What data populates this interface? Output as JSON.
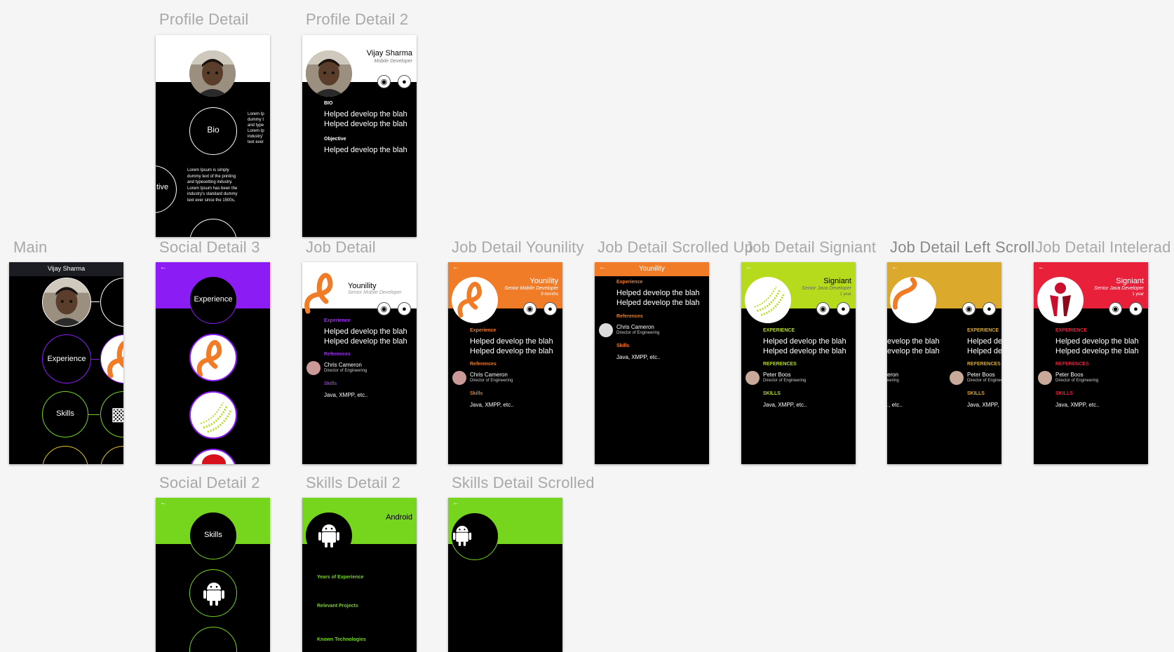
{
  "labels": {
    "profile_detail": "Profile Detail",
    "profile_detail_2": "Profile Detail 2",
    "main": "Main",
    "social_detail_3": "Social Detail 3",
    "job_detail": "Job Detail",
    "job_detail_younility": "Job Detail Younility",
    "job_detail_scrolled_up": "Job Detail Scrolled Up",
    "job_detail_signiant": "Job Detail Signiant",
    "job_detail_left_scroll": "Job Detail Left Scroll",
    "job_detail_intelerad": "Job Detail Intelerad",
    "social_detail_2": "Social Detail 2",
    "skills_detail_2": "Skills Detail 2",
    "skills_detail_scrolled": "Skills Detail Scrolled"
  },
  "profile": {
    "name": "Vijay Sharma",
    "role": "Mobile Developer",
    "bio_label": "Bio",
    "bio_heading": "BIO",
    "objective_heading": "Objective",
    "objective_fragment": "tive",
    "helped": "Helped develop the blah",
    "lorem_short": "Lorem Ip\ndummy t\nand type\nLorem Ip\nindustry'\ntext ever",
    "lorem_long": "Lorem Ipsum is simply\ndummy text of the printing\nand typesetting industry.\nLorem Ipsum has been the\nindustry's standard dummy\ntext ever since the 1500s,"
  },
  "main": {
    "title": "Vijay Sharma",
    "experience": "Experience",
    "skills": "Skills"
  },
  "job": {
    "experience_heading": "Experience",
    "experience_heading_caps": "EXPERIENCE",
    "references_heading": "References",
    "references_heading_caps": "REFERENCES",
    "skills_heading": "Skills",
    "skills_heading_caps": "SKILLS",
    "skills_value": "Java, XMPP, etc..",
    "ref_chris": "Chris Cameron",
    "ref_peter": "Peter Boos",
    "ref_role": "Director of Engineering",
    "younility": "Younility",
    "younility_role": "Senior Mobile Developer",
    "younility_dur": "9 months",
    "signiant": "Signiant",
    "signiant_role": "Senior Java Developer",
    "signiant_dur": "1 year",
    "intelerad": "Signiant",
    "intelerad_role": "Senior Java Developer",
    "intelerad_dur": "1 year",
    "left_fragment_1": "evelop the blah",
    "left_fragment_2": "evelop the blah",
    "left_frag_ron": "eron",
    "left_frag_eering": "eering",
    "left_frag_etc": "., etc..",
    "left_exp": "EXPERIENCE",
    "left_helped": "Helped dev",
    "left_java": "Java, XMPP,",
    "left_refs": "REFERENCES"
  },
  "social": {
    "experience": "Experience",
    "skills": "Skills"
  },
  "skills": {
    "android": "Android",
    "years": "Years of Experience",
    "projects": "Relevant Projects",
    "technologies": "Known Technologies"
  },
  "colors": {
    "purple": "#8b1cf4",
    "orange": "#f07c28",
    "lime": "#b6db1d",
    "gold": "#dba92c",
    "red": "#e8203a",
    "green": "#76d51d"
  },
  "icons": {
    "globe": "globe-icon",
    "pin": "map-pin-icon",
    "back": "back-arrow-icon",
    "android": "android-icon"
  }
}
